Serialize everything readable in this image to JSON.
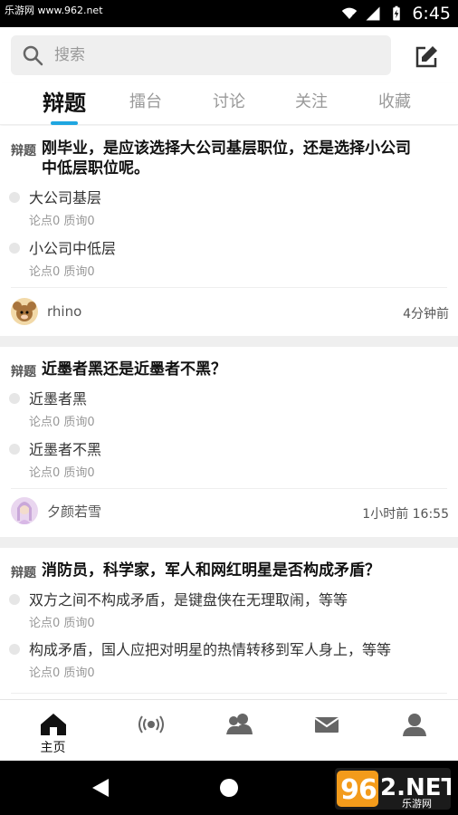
{
  "status": {
    "watermark": "乐游网 www.962.net",
    "time": "6:45"
  },
  "search": {
    "placeholder": "搜索"
  },
  "tabs": [
    {
      "label": "辩题",
      "active": true
    },
    {
      "label": "擂台"
    },
    {
      "label": "讨论"
    },
    {
      "label": "关注"
    },
    {
      "label": "收藏"
    }
  ],
  "posts": [
    {
      "tag": "辩题",
      "title": "刚毕业，是应该选择大公司基层职位，还是选择小公司中低层职位呢。",
      "options": [
        {
          "text": "大公司基层",
          "meta": "论点0 质询0"
        },
        {
          "text": "小公司中低层",
          "meta": "论点0 质询0"
        }
      ],
      "author": "rhino",
      "time": "4分钟前"
    },
    {
      "tag": "辩题",
      "title": "近墨者黑还是近墨者不黑？",
      "options": [
        {
          "text": "近墨者黑",
          "meta": "论点0 质询0"
        },
        {
          "text": "近墨者不黑",
          "meta": "论点0 质询0"
        }
      ],
      "author": "夕颜若雪",
      "time": "1小时前 16:55"
    },
    {
      "tag": "辩题",
      "title": "消防员，科学家，军人和网红明星是否构成矛盾？",
      "options": [
        {
          "text": "双方之间不构成矛盾，是键盘侠在无理取闹，等等",
          "meta": "论点0 质询0"
        },
        {
          "text": "构成矛盾，国人应把对明星的热情转移到军人身上，等等",
          "meta": "论点0 质询0"
        }
      ]
    }
  ],
  "bottom_nav": [
    {
      "icon": "home-icon",
      "label": "主页",
      "active": true
    },
    {
      "icon": "broadcast-icon",
      "label": ""
    },
    {
      "icon": "group-icon",
      "label": ""
    },
    {
      "icon": "mail-icon",
      "label": ""
    },
    {
      "icon": "profile-icon",
      "label": ""
    }
  ],
  "logo": {
    "text": "962.NET",
    "sub": "乐游网"
  },
  "colors": {
    "accent": "#1fa6e0",
    "text": "#111111",
    "muted": "#999999"
  }
}
